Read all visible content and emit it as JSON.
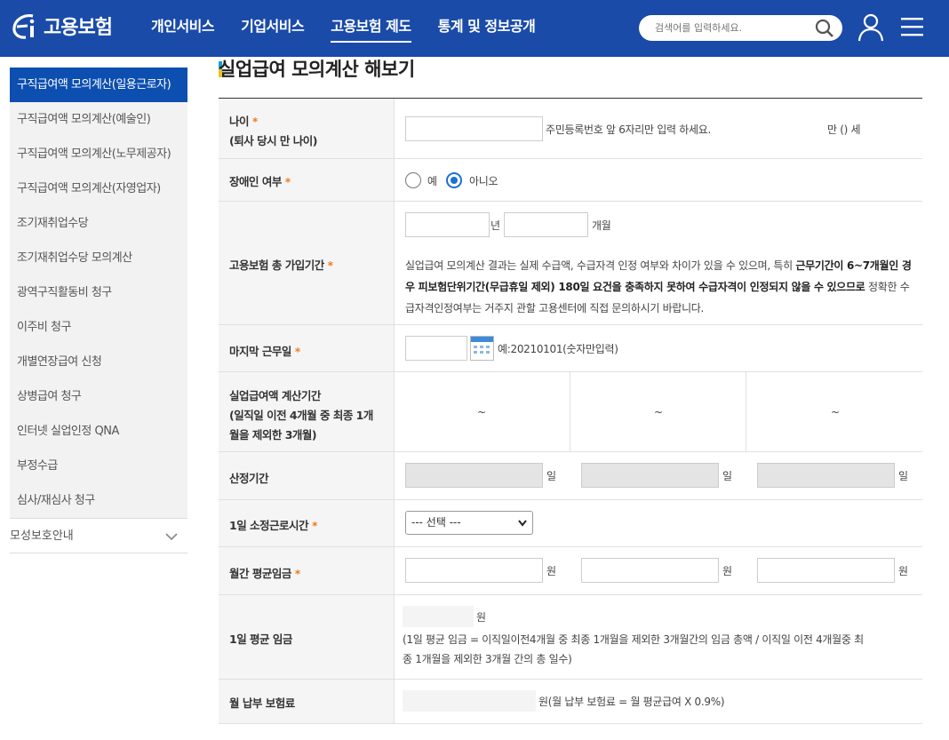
{
  "header": {
    "logo_text": "고용보험",
    "nav": [
      "개인서비스",
      "기업서비스",
      "고용보험 제도",
      "통계 및 정보공개"
    ],
    "search_placeholder": "검색어를 입력하세요."
  },
  "sidebar": {
    "items": [
      "구직급여액 모의계산(일용근로자)",
      "구직급여액 모의계산(예술인)",
      "구직급여액 모의계산(노무제공자)",
      "구직급여액 모의계산(자영업자)",
      "조기재취업수당",
      "조기재취업수당 모의계산",
      "광역구직활동비 청구",
      "이주비 청구",
      "개별연장급여 신청",
      "상병급여 청구",
      "인터넷 실업인정 QNA",
      "부정수급",
      "심사/재심사 청구"
    ],
    "group": "모성보호안내"
  },
  "main": {
    "title": "실업급여 모의계산 해보기",
    "age": {
      "label1": "나이",
      "label2": "(퇴사 당시 만 나이)",
      "hint": "주민등록번호 앞 6자리만 입력 하세요.",
      "result": "만 () 세"
    },
    "disability": {
      "label": "장애인 여부",
      "yes": "예",
      "no": "아니오"
    },
    "period": {
      "label": "고용보험 총 가입기간",
      "year_unit": "년",
      "month_unit": "개월",
      "notice_1": "실업급여 모의계산 결과는 실제 수급액, 수급자격 인정 여부와 차이가 있을 수 있으며, 특히 ",
      "notice_bold": "근무기간이 6~7개월인 경우 피보험단위기간(무급휴일 제외) 180일 요건을 충족하지 못하여 수급자격이 인정되지 않을 수 있으므로",
      "notice_2": " 정확한 수급자격인정여부는 거주지 관할 고용센터에 직접 문의하시기 바랍니다."
    },
    "last_day": {
      "label": "마지막 근무일",
      "hint": "예:20210101(숫자만입력)"
    },
    "calc_period": {
      "label1": "실업급여액 계산기간",
      "label2": "(일직일 이전 4개월 중 최종 1개",
      "label3": "월을 제외한 3개월)",
      "sep": "~"
    },
    "calc_days": {
      "label": "산정기간",
      "unit": "일"
    },
    "daily_hours": {
      "label": "1일 소정근로시간",
      "select": "--- 선택 ---"
    },
    "monthly_wage": {
      "label": "월간 평균임금",
      "unit": "원"
    },
    "daily_wage": {
      "label": "1일 평균 임금",
      "unit": "원",
      "formula1": "(1일 평균 임금 = 이직일이전4개월 중 최종 1개월을 제외한 3개월간의 임금 총액 / 이직일 이전 4개월중 최",
      "formula2": "종 1개월을 제외한 3개월 간의 총 일수)"
    },
    "premium": {
      "label": "월 납부 보험료",
      "note": "원(월 납부 보험료 = 월 평균급여 X 0.9%)"
    }
  }
}
